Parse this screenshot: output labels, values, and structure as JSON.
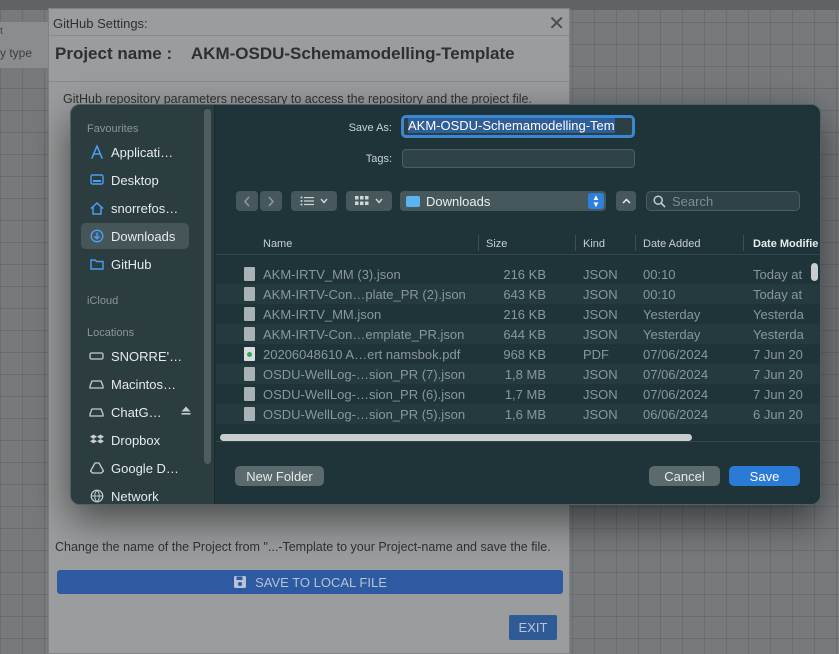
{
  "background": {
    "left_label_top": "t",
    "left_label": "y type",
    "github_panel": {
      "title": "GitHub Settings:",
      "close_glyph": "✕",
      "project_label": "Project name :",
      "project_name": "AKM-OSDU-Schemamodelling-Template",
      "description": "GitHub repository parameters necessary to access the repository and the project file.",
      "change_name_text": "Change the name of the Project from \"...-Template to your Project-name and save the file.",
      "save_button": "SAVE TO LOCAL FILE",
      "exit_button": "EXIT"
    }
  },
  "dialog": {
    "sidebar": {
      "favourites_header": "Favourites",
      "favourites": [
        {
          "label": "Applicati…",
          "icon": "applications-icon"
        },
        {
          "label": "Desktop",
          "icon": "desktop-icon"
        },
        {
          "label": "snorrefos…",
          "icon": "home-icon"
        },
        {
          "label": "Downloads",
          "icon": "downloads-icon",
          "active": true
        },
        {
          "label": "GitHub",
          "icon": "folder-icon"
        }
      ],
      "icloud_header": "iCloud",
      "locations_header": "Locations",
      "locations": [
        {
          "label": "SNORRE'…",
          "icon": "drive-icon"
        },
        {
          "label": "Macintos…",
          "icon": "harddisk-icon"
        },
        {
          "label": "ChatG…",
          "icon": "harddisk-icon"
        },
        {
          "label": "Dropbox",
          "icon": "dropbox-icon"
        },
        {
          "label": "Google D…",
          "icon": "google-drive-icon"
        },
        {
          "label": "Network",
          "icon": "network-icon"
        }
      ]
    },
    "save_as_label": "Save As:",
    "save_as_value": "AKM-OSDU-Schemamodelling-Tem",
    "tags_label": "Tags:",
    "tags_value": "",
    "location": "Downloads",
    "search_placeholder": "Search",
    "columns": [
      "Name",
      "Size",
      "Kind",
      "Date Added",
      "Date Modifie"
    ],
    "files": [
      {
        "name": "AKM-IRTV_MM (3).json",
        "size": "216 KB",
        "kind": "JSON",
        "added": "00:10",
        "modified": "Today at",
        "type": "json"
      },
      {
        "name": "AKM-IRTV-Con…plate_PR (2).json",
        "size": "643 KB",
        "kind": "JSON",
        "added": "00:10",
        "modified": "Today at",
        "type": "json"
      },
      {
        "name": "AKM-IRTV_MM.json",
        "size": "216 KB",
        "kind": "JSON",
        "added": "Yesterday",
        "modified": "Yesterda",
        "type": "json"
      },
      {
        "name": "AKM-IRTV-Con…emplate_PR.json",
        "size": "644 KB",
        "kind": "JSON",
        "added": "Yesterday",
        "modified": "Yesterda",
        "type": "json"
      },
      {
        "name": "20206048610 A…ert namsbok.pdf",
        "size": "968 KB",
        "kind": "PDF",
        "added": "07/06/2024",
        "modified": "7 Jun 20",
        "type": "pdf"
      },
      {
        "name": "OSDU-WellLog-…sion_PR (7).json",
        "size": "1,8 MB",
        "kind": "JSON",
        "added": "07/06/2024",
        "modified": "7 Jun 20",
        "type": "json"
      },
      {
        "name": "OSDU-WellLog-…sion_PR (6).json",
        "size": "1,7 MB",
        "kind": "JSON",
        "added": "07/06/2024",
        "modified": "7 Jun 20",
        "type": "json"
      },
      {
        "name": "OSDU-WellLog-…sion_PR (5).json",
        "size": "1,6 MB",
        "kind": "JSON",
        "added": "06/06/2024",
        "modified": "6 Jun 20",
        "type": "json"
      }
    ],
    "new_folder_button": "New Folder",
    "cancel_button": "Cancel",
    "save_button": "Save"
  }
}
